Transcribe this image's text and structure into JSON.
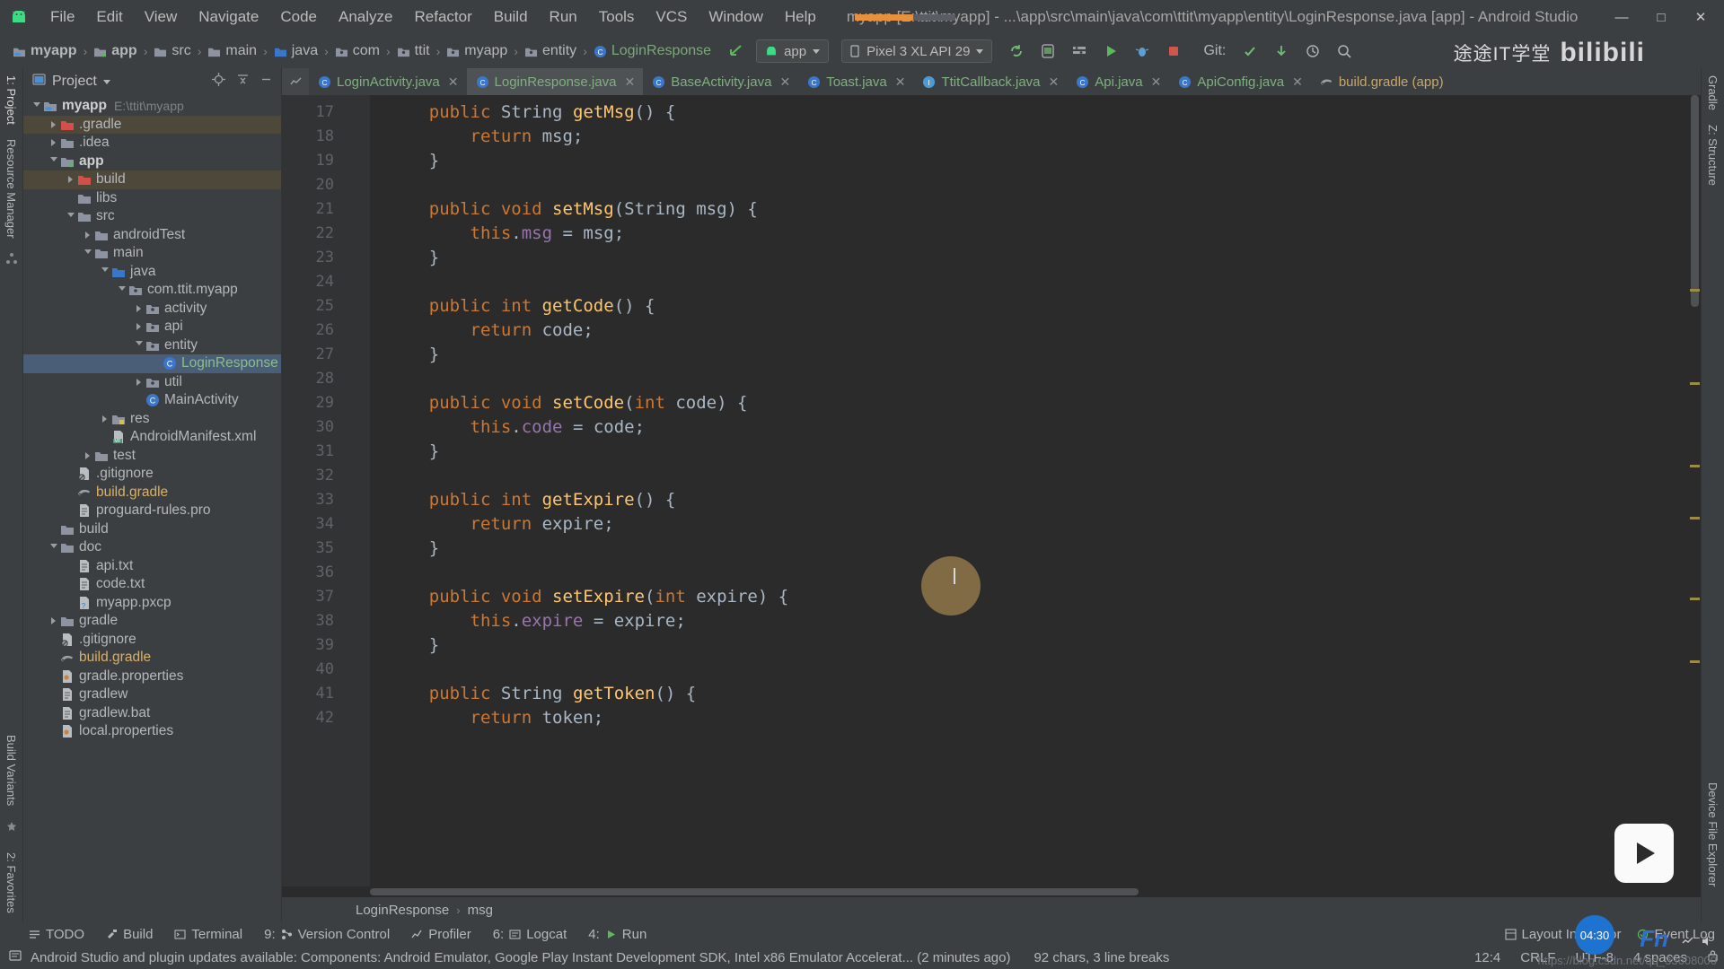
{
  "titlebar": {
    "menus": [
      "File",
      "Edit",
      "View",
      "Navigate",
      "Code",
      "Analyze",
      "Refactor",
      "Build",
      "Run",
      "Tools",
      "VCS",
      "Window",
      "Help"
    ],
    "window_title": "myapp [E:\\ttit\\myapp] - ...\\app\\src\\main\\java\\com\\ttit\\myapp\\entity\\LoginResponse.java [app] - Android Studio",
    "minimize": "—",
    "maximize": "□",
    "close": "✕",
    "logo_icon": "android-logo-icon"
  },
  "navbar": {
    "breadcrumbs": [
      {
        "label": "myapp",
        "icon": "module-folder-icon",
        "bold": true
      },
      {
        "label": "app",
        "icon": "app-module-icon",
        "bold": true
      },
      {
        "label": "src",
        "icon": "folder-icon"
      },
      {
        "label": "main",
        "icon": "folder-icon"
      },
      {
        "label": "java",
        "icon": "source-folder-icon"
      },
      {
        "label": "com",
        "icon": "package-icon"
      },
      {
        "label": "ttit",
        "icon": "package-icon"
      },
      {
        "label": "myapp",
        "icon": "package-icon"
      },
      {
        "label": "entity",
        "icon": "package-icon"
      },
      {
        "label": "LoginResponse",
        "icon": "java-class-icon"
      }
    ],
    "separator": "›",
    "run_config": "app",
    "device": "Pixel 3 XL API 29",
    "git_label": "Git:",
    "back_icon": "back-arrow-icon",
    "toolbar_icons": [
      "sync-gradle-icon",
      "avd-manager-icon",
      "sdk-manager-icon",
      "run-icon",
      "debug-icon",
      "stop-icon",
      "commit-icon",
      "update-icon",
      "history-icon"
    ],
    "brand_cn": "途途IT学堂",
    "brand_bili": "bilibili"
  },
  "project_panel": {
    "title": "Project",
    "dropdown_icon": "chevron-down-icon",
    "locate_icon": "target-icon",
    "collapse_icon": "collapse-all-icon",
    "hide_icon": "hide-icon",
    "tree": [
      {
        "depth": 0,
        "label": "myapp",
        "sub": "E:\\ttit\\myapp",
        "icon": "module-folder-icon",
        "arrow": "open",
        "bold": true,
        "style": "b"
      },
      {
        "depth": 1,
        "label": ".gradle",
        "icon": "excluded-folder-icon",
        "arrow": "closed",
        "hl": true
      },
      {
        "depth": 1,
        "label": ".idea",
        "icon": "folder-icon",
        "arrow": "closed"
      },
      {
        "depth": 1,
        "label": "app",
        "icon": "app-module-icon",
        "arrow": "open",
        "style": "b"
      },
      {
        "depth": 2,
        "label": "build",
        "icon": "excluded-folder-icon",
        "arrow": "closed",
        "hl": true
      },
      {
        "depth": 2,
        "label": "libs",
        "icon": "folder-icon",
        "arrow": "none"
      },
      {
        "depth": 2,
        "label": "src",
        "icon": "folder-icon",
        "arrow": "open"
      },
      {
        "depth": 3,
        "label": "androidTest",
        "icon": "folder-icon",
        "arrow": "closed"
      },
      {
        "depth": 3,
        "label": "main",
        "icon": "folder-icon",
        "arrow": "open"
      },
      {
        "depth": 4,
        "label": "java",
        "icon": "source-folder-icon",
        "arrow": "open"
      },
      {
        "depth": 5,
        "label": "com.ttit.myapp",
        "icon": "package-icon",
        "arrow": "open"
      },
      {
        "depth": 6,
        "label": "activity",
        "icon": "package-icon",
        "arrow": "closed"
      },
      {
        "depth": 6,
        "label": "api",
        "icon": "package-icon",
        "arrow": "closed"
      },
      {
        "depth": 6,
        "label": "entity",
        "icon": "package-icon",
        "arrow": "open"
      },
      {
        "depth": 7,
        "label": "LoginResponse",
        "icon": "java-class-icon",
        "arrow": "none",
        "sel": true,
        "style": "green"
      },
      {
        "depth": 6,
        "label": "util",
        "icon": "package-icon",
        "arrow": "closed"
      },
      {
        "depth": 6,
        "label": "MainActivity",
        "icon": "java-class-icon",
        "arrow": "none"
      },
      {
        "depth": 4,
        "label": "res",
        "icon": "res-folder-icon",
        "arrow": "closed"
      },
      {
        "depth": 4,
        "label": "AndroidManifest.xml",
        "icon": "manifest-icon",
        "arrow": "none"
      },
      {
        "depth": 3,
        "label": "test",
        "icon": "folder-icon",
        "arrow": "closed"
      },
      {
        "depth": 2,
        "label": ".gitignore",
        "icon": "gitignore-icon",
        "arrow": "none"
      },
      {
        "depth": 2,
        "label": "build.gradle",
        "icon": "gradle-icon",
        "arrow": "none",
        "style": "gradlefile"
      },
      {
        "depth": 2,
        "label": "proguard-rules.pro",
        "icon": "text-file-icon",
        "arrow": "none"
      },
      {
        "depth": 1,
        "label": "build",
        "icon": "folder-icon",
        "arrow": "none"
      },
      {
        "depth": 1,
        "label": "doc",
        "icon": "folder-icon",
        "arrow": "open"
      },
      {
        "depth": 2,
        "label": "api.txt",
        "icon": "text-file-icon",
        "arrow": "none"
      },
      {
        "depth": 2,
        "label": "code.txt",
        "icon": "text-file-icon",
        "arrow": "none"
      },
      {
        "depth": 2,
        "label": "myapp.pxcp",
        "icon": "unknown-file-icon",
        "arrow": "none"
      },
      {
        "depth": 1,
        "label": "gradle",
        "icon": "folder-icon",
        "arrow": "closed"
      },
      {
        "depth": 1,
        "label": ".gitignore",
        "icon": "gitignore-icon",
        "arrow": "none"
      },
      {
        "depth": 1,
        "label": "build.gradle",
        "icon": "gradle-icon",
        "arrow": "none",
        "style": "gradlefile"
      },
      {
        "depth": 1,
        "label": "gradle.properties",
        "icon": "properties-icon",
        "arrow": "none"
      },
      {
        "depth": 1,
        "label": "gradlew",
        "icon": "text-file-icon",
        "arrow": "none"
      },
      {
        "depth": 1,
        "label": "gradlew.bat",
        "icon": "text-file-icon",
        "arrow": "none"
      },
      {
        "depth": 1,
        "label": "local.properties",
        "icon": "properties-icon",
        "arrow": "none"
      }
    ]
  },
  "left_rail": [
    "1: Project",
    "Resource Manager",
    "Build Variants",
    "2: Favorites"
  ],
  "right_rail": [
    "Gradle",
    "Z: Structure",
    "Device File Explorer"
  ],
  "editor": {
    "tabs": [
      {
        "label": "LoginActivity.java",
        "icon": "java-class-icon",
        "active": false,
        "close": "✕",
        "color": "green"
      },
      {
        "label": "LoginResponse.java",
        "icon": "java-class-icon",
        "active": true,
        "close": "✕",
        "color": "green"
      },
      {
        "label": "BaseActivity.java",
        "icon": "java-class-icon",
        "active": false,
        "close": "✕",
        "color": "green"
      },
      {
        "label": "Toast.java",
        "icon": "java-class-icon",
        "active": false,
        "close": "✕",
        "color": "green"
      },
      {
        "label": "TtitCallback.java",
        "icon": "java-interface-icon",
        "active": false,
        "close": "✕",
        "color": "green"
      },
      {
        "label": "Api.java",
        "icon": "java-class-icon",
        "active": false,
        "close": "✕",
        "color": "green"
      },
      {
        "label": "ApiConfig.java",
        "icon": "java-class-icon",
        "active": false,
        "close": "✕",
        "color": "green"
      },
      {
        "label": "build.gradle (app)",
        "icon": "gradle-icon",
        "active": false,
        "close": "",
        "color": "gold"
      }
    ],
    "first_line_number": 17,
    "lines": [
      {
        "n": 17,
        "fold": "-",
        "tokens": [
          {
            "t": "    ",
            "c": "pn"
          },
          {
            "t": "public ",
            "c": "kw"
          },
          {
            "t": "String",
            "c": "ty"
          },
          {
            "t": " ",
            "c": "pn"
          },
          {
            "t": "getMsg",
            "c": "fn"
          },
          {
            "t": "() {",
            "c": "pn"
          }
        ]
      },
      {
        "n": 18,
        "fold": "",
        "tokens": [
          {
            "t": "        ",
            "c": "pn"
          },
          {
            "t": "return",
            "c": "kw"
          },
          {
            "t": " msg;",
            "c": "pn"
          }
        ]
      },
      {
        "n": 19,
        "fold": "",
        "tokens": [
          {
            "t": "    }",
            "c": "pn"
          }
        ]
      },
      {
        "n": 20,
        "fold": "",
        "tokens": [
          {
            "t": "",
            "c": "pn"
          }
        ]
      },
      {
        "n": 21,
        "fold": "-",
        "tokens": [
          {
            "t": "    ",
            "c": "pn"
          },
          {
            "t": "public void ",
            "c": "kw"
          },
          {
            "t": "setMsg",
            "c": "fn"
          },
          {
            "t": "(",
            "c": "pn"
          },
          {
            "t": "String",
            "c": "ty"
          },
          {
            "t": " msg) {",
            "c": "pn"
          }
        ]
      },
      {
        "n": 22,
        "fold": "",
        "tokens": [
          {
            "t": "        ",
            "c": "pn"
          },
          {
            "t": "this",
            "c": "kw"
          },
          {
            "t": ".",
            "c": "pn"
          },
          {
            "t": "msg",
            "c": "fld"
          },
          {
            "t": " = msg;",
            "c": "pn"
          }
        ]
      },
      {
        "n": 23,
        "fold": "",
        "tokens": [
          {
            "t": "    }",
            "c": "pn"
          }
        ]
      },
      {
        "n": 24,
        "fold": "",
        "tokens": [
          {
            "t": "",
            "c": "pn"
          }
        ]
      },
      {
        "n": 25,
        "fold": "-",
        "tokens": [
          {
            "t": "    ",
            "c": "pn"
          },
          {
            "t": "public int ",
            "c": "kw"
          },
          {
            "t": "getCode",
            "c": "fn"
          },
          {
            "t": "() {",
            "c": "pn"
          }
        ]
      },
      {
        "n": 26,
        "fold": "",
        "tokens": [
          {
            "t": "        ",
            "c": "pn"
          },
          {
            "t": "return",
            "c": "kw"
          },
          {
            "t": " code;",
            "c": "pn"
          }
        ]
      },
      {
        "n": 27,
        "fold": "",
        "tokens": [
          {
            "t": "    }",
            "c": "pn"
          }
        ]
      },
      {
        "n": 28,
        "fold": "",
        "tokens": [
          {
            "t": "",
            "c": "pn"
          }
        ]
      },
      {
        "n": 29,
        "fold": "-",
        "tokens": [
          {
            "t": "    ",
            "c": "pn"
          },
          {
            "t": "public void ",
            "c": "kw"
          },
          {
            "t": "setCode",
            "c": "fn"
          },
          {
            "t": "(",
            "c": "pn"
          },
          {
            "t": "int",
            "c": "kw"
          },
          {
            "t": " code) {",
            "c": "pn"
          }
        ]
      },
      {
        "n": 30,
        "fold": "",
        "tokens": [
          {
            "t": "        ",
            "c": "pn"
          },
          {
            "t": "this",
            "c": "kw"
          },
          {
            "t": ".",
            "c": "pn"
          },
          {
            "t": "code",
            "c": "fld"
          },
          {
            "t": " = code;",
            "c": "pn"
          }
        ]
      },
      {
        "n": 31,
        "fold": "",
        "tokens": [
          {
            "t": "    }",
            "c": "pn"
          }
        ]
      },
      {
        "n": 32,
        "fold": "",
        "tokens": [
          {
            "t": "",
            "c": "pn"
          }
        ]
      },
      {
        "n": 33,
        "fold": "-",
        "tokens": [
          {
            "t": "    ",
            "c": "pn"
          },
          {
            "t": "public int ",
            "c": "kw"
          },
          {
            "t": "getExpire",
            "c": "fn"
          },
          {
            "t": "() {",
            "c": "pn"
          }
        ]
      },
      {
        "n": 34,
        "fold": "",
        "tokens": [
          {
            "t": "        ",
            "c": "pn"
          },
          {
            "t": "return",
            "c": "kw"
          },
          {
            "t": " expire;",
            "c": "pn"
          }
        ]
      },
      {
        "n": 35,
        "fold": "",
        "tokens": [
          {
            "t": "    }",
            "c": "pn"
          }
        ]
      },
      {
        "n": 36,
        "fold": "",
        "tokens": [
          {
            "t": "",
            "c": "pn"
          }
        ]
      },
      {
        "n": 37,
        "fold": "-",
        "tokens": [
          {
            "t": "    ",
            "c": "pn"
          },
          {
            "t": "public void ",
            "c": "kw"
          },
          {
            "t": "setExpire",
            "c": "fn"
          },
          {
            "t": "(",
            "c": "pn"
          },
          {
            "t": "int",
            "c": "kw"
          },
          {
            "t": " expire) {",
            "c": "pn"
          }
        ]
      },
      {
        "n": 38,
        "fold": "",
        "tokens": [
          {
            "t": "        ",
            "c": "pn"
          },
          {
            "t": "this",
            "c": "kw"
          },
          {
            "t": ".",
            "c": "pn"
          },
          {
            "t": "expire",
            "c": "fld"
          },
          {
            "t": " = expire;",
            "c": "pn"
          }
        ]
      },
      {
        "n": 39,
        "fold": "",
        "tokens": [
          {
            "t": "    }",
            "c": "pn"
          }
        ]
      },
      {
        "n": 40,
        "fold": "",
        "tokens": [
          {
            "t": "",
            "c": "pn"
          }
        ]
      },
      {
        "n": 41,
        "fold": "-",
        "tokens": [
          {
            "t": "    ",
            "c": "pn"
          },
          {
            "t": "public ",
            "c": "kw"
          },
          {
            "t": "String",
            "c": "ty"
          },
          {
            "t": " ",
            "c": "pn"
          },
          {
            "t": "getToken",
            "c": "fn"
          },
          {
            "t": "() {",
            "c": "pn"
          }
        ]
      },
      {
        "n": 42,
        "fold": "",
        "tokens": [
          {
            "t": "        ",
            "c": "pn"
          },
          {
            "t": "return",
            "c": "kw"
          },
          {
            "t": " token;",
            "c": "pn"
          }
        ]
      }
    ],
    "breadcrumb_bottom": [
      "LoginResponse",
      "msg"
    ],
    "breadcrumb_sep": "›"
  },
  "bottom_toolwindows": [
    {
      "label": "TODO",
      "icon": "todo-icon",
      "num": ""
    },
    {
      "label": "Build",
      "icon": "build-icon",
      "num": ""
    },
    {
      "label": "Terminal",
      "icon": "terminal-icon",
      "num": ""
    },
    {
      "label": "Version Control",
      "icon": "vcs-icon",
      "num": "9:"
    },
    {
      "label": "Profiler",
      "icon": "profiler-icon",
      "num": ""
    },
    {
      "label": "Logcat",
      "icon": "logcat-icon",
      "num": "6:"
    },
    {
      "label": "Run",
      "icon": "run-icon",
      "num": "4:"
    }
  ],
  "bottom_right_toolwindows": [
    {
      "label": "Layout Inspector",
      "icon": "layout-inspector-icon"
    },
    {
      "label": "Event Log",
      "icon": "event-log-icon"
    }
  ],
  "statusbar": {
    "message": "Android Studio and plugin updates available: Components: Android Emulator, Google Play Instant Development SDK, Intel x86 Emulator Accelerat... (2 minutes ago)",
    "char_count": "92 chars, 3 line breaks",
    "caret_pos": "12:4",
    "line_sep": "CRLF",
    "encoding": "UTF-8",
    "indent": "4 spaces",
    "lock_icon": "lock-icon",
    "event_icon": "event-icon"
  },
  "overlays": {
    "clock_time": "04:30",
    "fn_key": "Fn",
    "watermark": "https://blog.csdn.net/qq_33608000",
    "play_icon": "play-button-icon"
  },
  "colors": {
    "bg_chrome": "#3c3f41",
    "bg_editor": "#2b2b2b",
    "gutter": "#313335",
    "selection": "#4b5e77",
    "accent_orange": "#e8913a",
    "keyword": "#cc7832",
    "method": "#ffc66d",
    "field": "#9876aa",
    "text": "#a9b7c6"
  }
}
